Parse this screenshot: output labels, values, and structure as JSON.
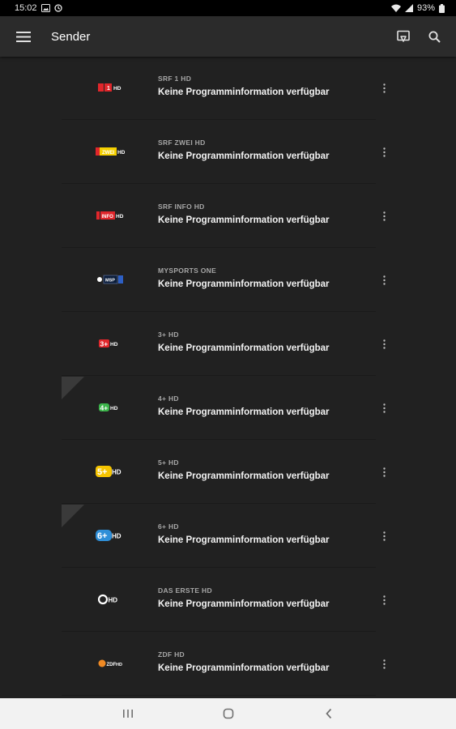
{
  "status": {
    "time": "15:02",
    "battery": "93%"
  },
  "appbar": {
    "title": "Sender"
  },
  "channels": [
    {
      "name": "SRF 1 HD",
      "info": "Keine Programminformation verfügbar",
      "logo": "srf1-logo"
    },
    {
      "name": "SRF ZWEI HD",
      "info": "Keine Programminformation verfügbar",
      "logo": "srf-zwei-logo"
    },
    {
      "name": "SRF INFO HD",
      "info": "Keine Programminformation verfügbar",
      "logo": "srf-info-logo"
    },
    {
      "name": "MYSPORTS ONE",
      "info": "Keine Programminformation verfügbar",
      "logo": "mysports-logo"
    },
    {
      "name": "3+ HD",
      "info": "Keine Programminformation verfügbar",
      "logo": "3plus-logo"
    },
    {
      "name": "4+ HD",
      "info": "Keine Programminformation verfügbar",
      "logo": "4plus-logo"
    },
    {
      "name": "5+ HD",
      "info": "Keine Programminformation verfügbar",
      "logo": "5plus-logo"
    },
    {
      "name": "6+ HD",
      "info": "Keine Programminformation verfügbar",
      "logo": "6plus-logo"
    },
    {
      "name": "DAS ERSTE HD",
      "info": "Keine Programminformation verfügbar",
      "logo": "das-erste-logo"
    },
    {
      "name": "ZDF HD",
      "info": "Keine Programminformation verfügbar",
      "logo": "zdf-logo"
    }
  ],
  "colors": {
    "background": "#212121",
    "appbar": "#2b2b2b",
    "srf_red": "#e0262b",
    "zwei_yellow": "#f5d000"
  }
}
